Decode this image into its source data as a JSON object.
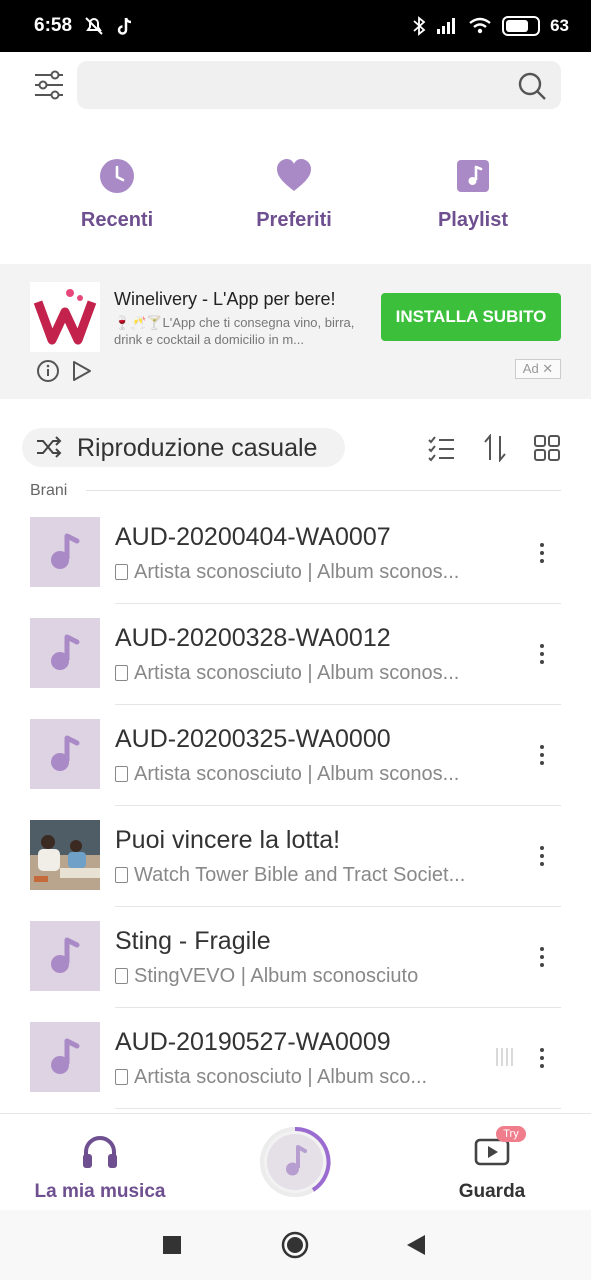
{
  "status_bar": {
    "time": "6:58",
    "battery": "63"
  },
  "search": {
    "placeholder": ""
  },
  "quick_access": [
    {
      "label": "Recenti",
      "icon": "clock-icon"
    },
    {
      "label": "Preferiti",
      "icon": "heart-icon"
    },
    {
      "label": "Playlist",
      "icon": "music-note-icon"
    }
  ],
  "ad": {
    "title": "Winelivery - L'App per bere!",
    "description": "🍷🥂🍸L'App che ti consegna vino, birra, drink e cocktail a domicilio in m...",
    "button": "INSTALLA SUBITO",
    "badge": "Ad ✕"
  },
  "shuffle_label": "Riproduzione casuale",
  "section_label": "Brani",
  "songs": [
    {
      "title": "AUD-20200404-WA0007",
      "subtitle": "Artista sconosciuto | Album sconos..."
    },
    {
      "title": "AUD-20200328-WA0012",
      "subtitle": "Artista sconosciuto | Album sconos..."
    },
    {
      "title": "AUD-20200325-WA0000",
      "subtitle": "Artista sconosciuto | Album sconos..."
    },
    {
      "title": "Puoi vincere la lotta!",
      "subtitle": "Watch Tower Bible and Tract Societ..."
    },
    {
      "title": "Sting - Fragile",
      "subtitle": "StingVEVO | Album sconosciuto"
    },
    {
      "title": "AUD-20190527-WA0009",
      "subtitle": "Artista sconosciuto | Album sco..."
    }
  ],
  "bottom_nav": {
    "my_music": "La mia musica",
    "watch": "Guarda",
    "try_badge": "Try"
  },
  "colors": {
    "accent": "#6e4f8f",
    "icon_purple": "#a98ac6",
    "ad_button": "#3cc03c"
  }
}
